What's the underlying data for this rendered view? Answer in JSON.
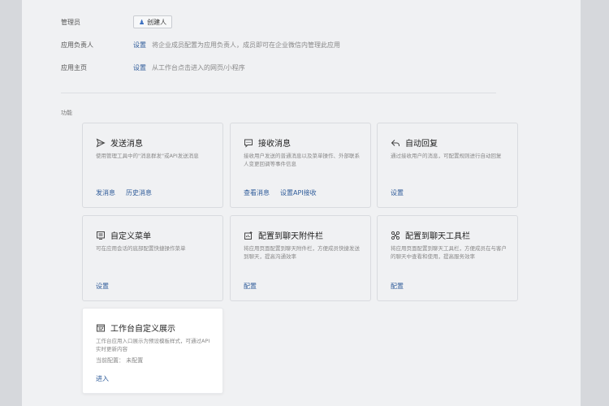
{
  "settings": {
    "admin": {
      "label": "管理员",
      "chip_label": "创建人"
    },
    "owner": {
      "label": "应用负责人",
      "link": "设置",
      "desc": "将企业成员配置为应用负责人，成员即可在企业微信内管理此应用"
    },
    "homepage": {
      "label": "应用主页",
      "link": "设置",
      "desc": "从工作台点击进入的网页/小程序"
    }
  },
  "section_title": "功能",
  "cards": [
    {
      "title": "发送消息",
      "icon": "send-icon",
      "desc": "使用管理工具中的\"消息群发\"或API发送消息",
      "links": [
        "发消息",
        "历史消息"
      ]
    },
    {
      "title": "接收消息",
      "icon": "chat-bubble-icon",
      "desc": "接收用户发送的普通消息以及菜单操作、外部联系人变更回调等事件信息",
      "links": [
        "查看消息",
        "设置API接收"
      ]
    },
    {
      "title": "自动回复",
      "icon": "reply-icon",
      "desc": "通过接收用户的消息，可配置规则进行自动回复",
      "links": [
        "设置"
      ]
    },
    {
      "title": "自定义菜单",
      "icon": "menu-icon",
      "desc": "可在应用会话的底部配置快捷操作菜单",
      "links": [
        "设置"
      ]
    },
    {
      "title": "配置到聊天附件栏",
      "icon": "attachment-bar-icon",
      "desc": "将应用页面配置到聊天附件栏，方便成员快捷发送到聊天，提高沟通效率",
      "links": [
        "配置"
      ]
    },
    {
      "title": "配置到聊天工具栏",
      "icon": "toolbar-icon",
      "desc": "将应用页面配置到聊天工具栏，方便成员在与客户的聊天中查看和使用，提高服务效率",
      "links": [
        "配置"
      ]
    },
    {
      "title": "工作台自定义展示",
      "icon": "workbench-icon",
      "desc": "工作台应用入口展示为预设模板样式，可通过API实时更新内容",
      "config": "当前配置：  未配置",
      "links": [
        "进入"
      ]
    }
  ]
}
